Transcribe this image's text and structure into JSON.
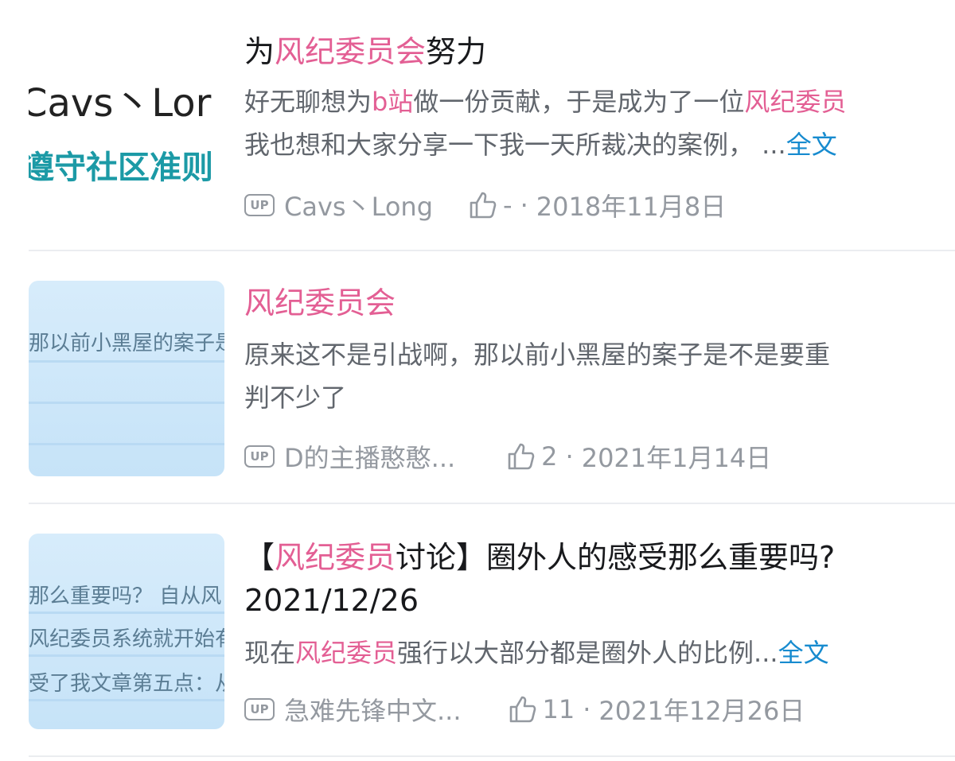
{
  "items": [
    {
      "thumb": {
        "line1": "Cavs丶Lor",
        "line2": "遵守社区准则"
      },
      "title": {
        "pre": "为",
        "hl": "风纪委员会",
        "post": "努力"
      },
      "desc": {
        "l1_pre": "好无聊想为",
        "l1_hl1": "b站",
        "l1_mid": "做一份贡献，于是成为了一位",
        "l1_hl2": "风纪委员",
        "l2": "我也想和大家分享一下我一天所裁决的案例， ...",
        "more": "全文"
      },
      "meta": {
        "up": "UP",
        "author": "Cavs丶Long",
        "likes": "-",
        "date": "2018年11月8日"
      }
    },
    {
      "thumb": {
        "line1": "那以前小黑屋的案子是"
      },
      "title": {
        "hl": "风纪委员会"
      },
      "desc": {
        "l1": "原来这不是引战啊，那以前小黑屋的案子是不是要重",
        "l2": "判不少了"
      },
      "meta": {
        "up": "UP",
        "author": "D的主播憨憨...",
        "likes": "2",
        "date": "2021年1月14日"
      }
    },
    {
      "thumb": {
        "line1": "那么重要吗？    自从风",
        "line2": "风纪委员系统就开始有",
        "line3": "受了我文章第五点：从"
      },
      "title": {
        "pre": "【",
        "hl": "风纪委员",
        "post": "讨论】圈外人的感受那么重要吗?",
        "l2": "2021/12/26"
      },
      "desc": {
        "l1_pre": "现在",
        "l1_hl": "风纪委员",
        "l1_post": "强行以大部分都是圈外人的比例...",
        "more": "全文"
      },
      "meta": {
        "up": "UP",
        "author": "急难先锋中文...",
        "likes": "11",
        "date": "2021年12月26日"
      }
    }
  ],
  "colors": {
    "highlight": "#e35f94",
    "link": "#178bcf",
    "meta": "#9499a0"
  }
}
